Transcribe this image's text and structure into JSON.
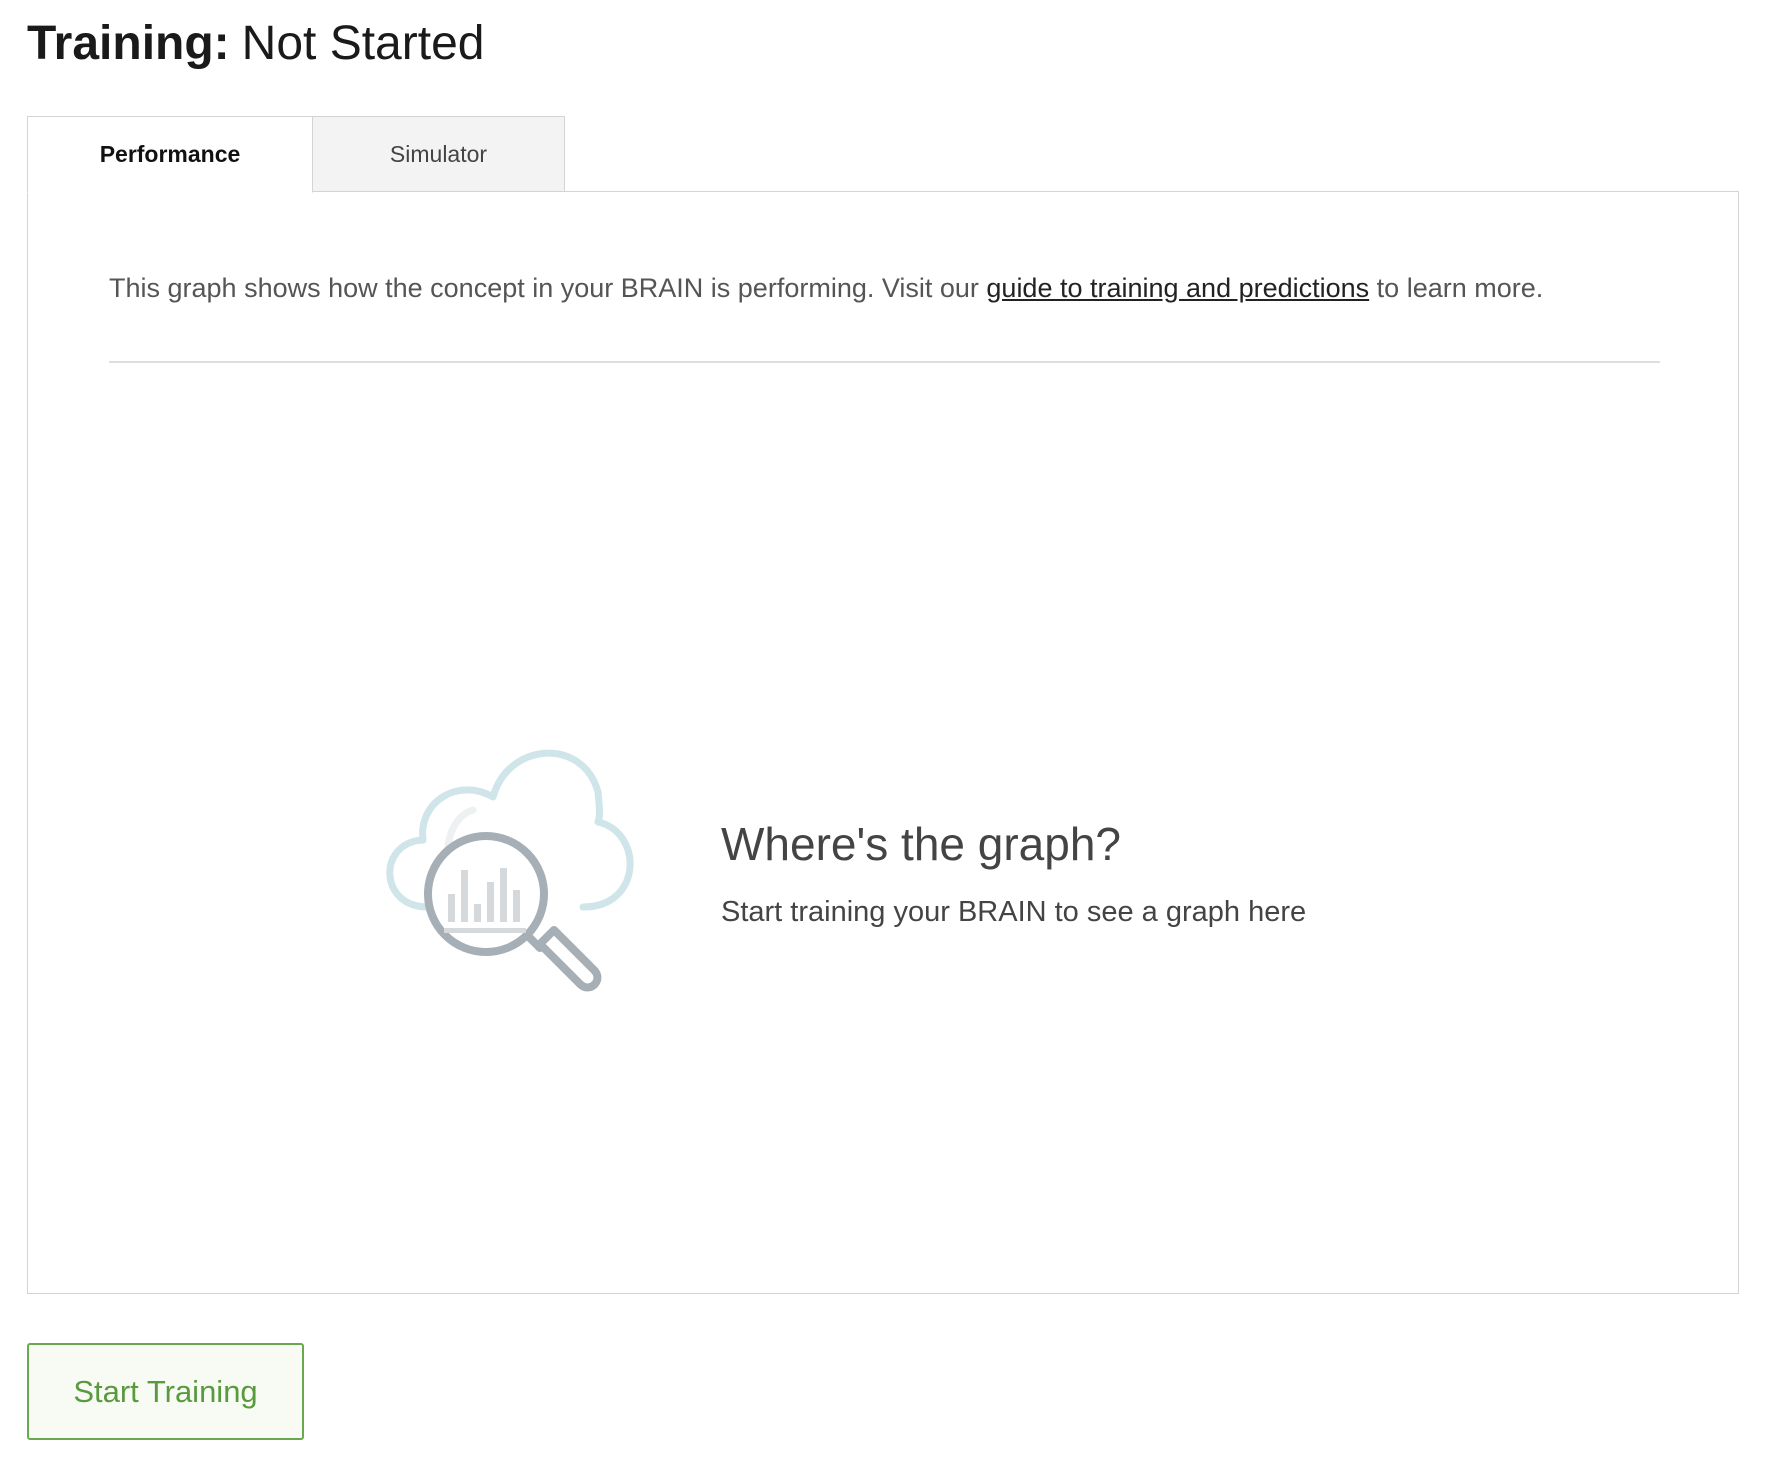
{
  "header": {
    "title_label": "Training:",
    "title_status": "Not Started"
  },
  "tabs": [
    {
      "label": "Performance",
      "active": true
    },
    {
      "label": "Simulator",
      "active": false
    }
  ],
  "panel": {
    "intro_before": "This graph shows how the concept in your BRAIN is performing. Visit our ",
    "intro_link": "guide to training and predictions",
    "intro_after": " to learn more.",
    "empty_state": {
      "icon": "cloud-magnifier-chart-icon",
      "title": "Where's the graph?",
      "subtitle": "Start training your BRAIN to see a graph here"
    }
  },
  "actions": {
    "start_training_label": "Start Training"
  },
  "colors": {
    "accent_green": "#5a9a3f",
    "cloud_blue": "#cfe5ea",
    "magnifier_gray": "#a6afb6",
    "border_gray": "#d4d4d4"
  }
}
